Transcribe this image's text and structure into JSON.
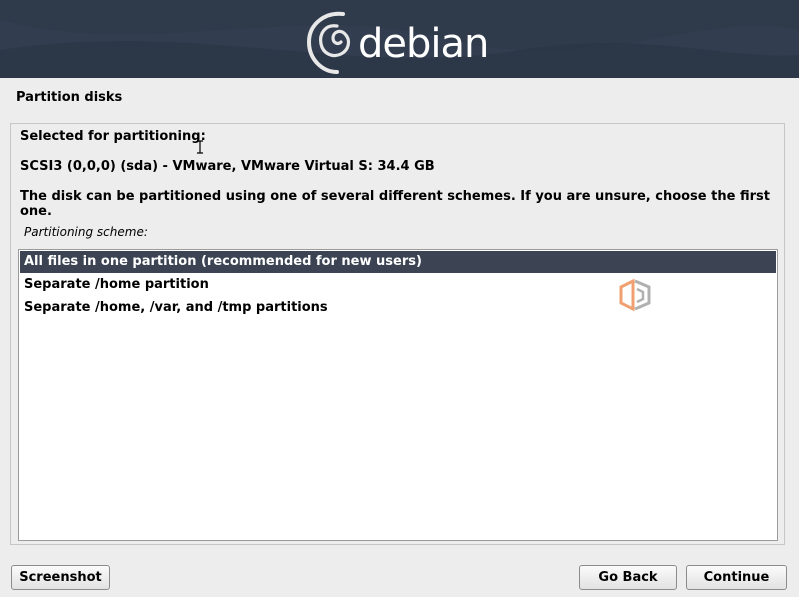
{
  "banner": {
    "logo_text": "debian",
    "logo_icon": "debian-swirl-icon"
  },
  "page": {
    "title": "Partition disks"
  },
  "content": {
    "heading": "Selected for partitioning:",
    "disk": "SCSI3 (0,0,0) (sda) - VMware, VMware Virtual S: 34.4 GB",
    "description": "The disk can be partitioned using one of several different schemes. If you are unsure, choose the first one.",
    "scheme_label": "Partitioning scheme:",
    "options": [
      {
        "label": "All files in one partition (recommended for new users)",
        "selected": true
      },
      {
        "label": "Separate /home partition",
        "selected": false
      },
      {
        "label": "Separate /home, /var, and /tmp partitions",
        "selected": false
      }
    ]
  },
  "buttons": {
    "screenshot": "Screenshot",
    "go_back": "Go Back",
    "continue": "Continue"
  },
  "colors": {
    "banner": "#2f3a4b",
    "selection": "#3c4453",
    "background": "#ededed"
  }
}
